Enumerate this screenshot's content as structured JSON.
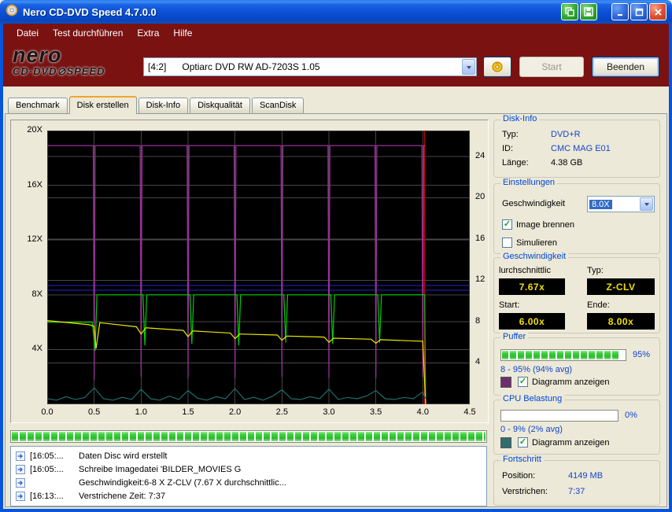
{
  "window": {
    "title": "Nero CD-DVD Speed 4.7.0.0",
    "menu_items": [
      "Datei",
      "Test durchführen",
      "Extra",
      "Hilfe"
    ],
    "logo": {
      "top": "nero",
      "bottom": "CD·DVD⊘SPEED"
    }
  },
  "toolbar": {
    "drive_select": "[4:2]      Optiarc DVD RW AD-7203S 1.05",
    "start_label": "Start",
    "quit_label": "Beenden"
  },
  "tabs": [
    {
      "label": "Benchmark",
      "active": false
    },
    {
      "label": "Disk erstellen",
      "active": true
    },
    {
      "label": "Disk-Info",
      "active": false
    },
    {
      "label": "Diskqualität",
      "active": false
    },
    {
      "label": "ScanDisk",
      "active": false
    }
  ],
  "disk_info": {
    "title": "Disk-Info",
    "rows": [
      {
        "label": "Typ:",
        "value": "DVD+R"
      },
      {
        "label": "ID:",
        "value": "CMC MAG E01"
      },
      {
        "label": "Länge:",
        "value": "4.38 GB"
      }
    ]
  },
  "settings": {
    "title": "Einstellungen",
    "speed_label": "Geschwindigkeit",
    "speed_value": "8.0X",
    "checkbox_burn": "Image brennen",
    "checkbox_sim": "Simulieren"
  },
  "speed_group": {
    "title": "Geschwindigkeit",
    "avg_label": "lurchschnittlic",
    "type_label": "Typ:",
    "avg_value": "7.67x",
    "type_value": "Z-CLV",
    "start_label": "Start:",
    "end_label": "Ende:",
    "start_value": "6.00x",
    "end_value": "8.00x"
  },
  "buffer_group": {
    "title": "Puffer",
    "percent": "95%",
    "range": "8 - 95% (94% avg)",
    "checkbox": "Diagramm anzeigen",
    "bar_percent": 95,
    "swatch_color": "#6e2e6e"
  },
  "cpu_group": {
    "title": "CPU Belastung",
    "percent": "0%",
    "range": "0 - 9% (2% avg)",
    "checkbox": "Diagramm anzeigen",
    "bar_percent": 0,
    "swatch_color": "#2e6e6e"
  },
  "progress_group": {
    "title": "Fortschritt",
    "rows": [
      {
        "label": "Position:",
        "value": "4149 MB"
      },
      {
        "label": "Verstrichen:",
        "value": "7:37"
      }
    ]
  },
  "main_progress": {
    "percent": 100
  },
  "log": {
    "entries": [
      {
        "time": "[16:05:...",
        "text": "Daten Disc wird erstellt"
      },
      {
        "time": "[16:05:...",
        "text": "Schreibe Imagedatei 'BILDER_MOVIES G"
      },
      {
        "time": "",
        "text": "Geschwindigkeit:6-8 X Z-CLV (7.67 X durchschnittlic..."
      },
      {
        "time": "[16:13:...",
        "text": "Verstrichene Zeit: 7:37"
      }
    ]
  },
  "chart_data": {
    "type": "line",
    "title": "DVD+R burn graph (speed / buffer / CPU vs. written GB)",
    "x_max": 4.5,
    "x_ticks": [
      0.0,
      0.5,
      1.0,
      1.5,
      2.0,
      2.5,
      3.0,
      3.5,
      4.0,
      4.5
    ],
    "left_axis": {
      "max": 20,
      "ticks": [
        4,
        8,
        12,
        16,
        20
      ],
      "tick_suffix": "X"
    },
    "right_axis": {
      "max": 26.5,
      "ticks": [
        4,
        8,
        12,
        16,
        20,
        24
      ]
    },
    "background": "#000000",
    "grid_color": "#464646",
    "hlines": [
      {
        "y": 8.33,
        "axis": "left",
        "color": "#2525d8"
      },
      {
        "y": 8.68,
        "axis": "left",
        "color": "#2525d8"
      }
    ],
    "vlines": [
      {
        "x": 4.02,
        "color": "#cc0000"
      }
    ],
    "series": [
      {
        "name": "buffer-level",
        "color": "#993399",
        "axis": "left",
        "points": [
          [
            0,
            18.9
          ],
          [
            0.49,
            18.9
          ],
          [
            0.5,
            1.8
          ],
          [
            0.51,
            18.9
          ],
          [
            0.99,
            18.9
          ],
          [
            1.0,
            2.0
          ],
          [
            1.01,
            18.9
          ],
          [
            1.49,
            18.9
          ],
          [
            1.5,
            1.9
          ],
          [
            1.51,
            18.9
          ],
          [
            1.99,
            18.9
          ],
          [
            2.0,
            1.9
          ],
          [
            2.01,
            18.9
          ],
          [
            2.49,
            18.9
          ],
          [
            2.5,
            2.0
          ],
          [
            2.51,
            18.9
          ],
          [
            2.99,
            18.9
          ],
          [
            3.0,
            1.9
          ],
          [
            3.01,
            18.9
          ],
          [
            3.49,
            18.9
          ],
          [
            3.5,
            1.9
          ],
          [
            3.51,
            18.9
          ],
          [
            3.99,
            18.9
          ],
          [
            4.0,
            2.0
          ],
          [
            4.01,
            18.9
          ],
          [
            4.03,
            18.9
          ]
        ]
      },
      {
        "name": "write-speed",
        "color": "#00cc00",
        "axis": "left",
        "points": [
          [
            0,
            6.0
          ],
          [
            0.48,
            6.0
          ],
          [
            0.51,
            3.9
          ],
          [
            0.53,
            8.0
          ],
          [
            1.02,
            8.0
          ],
          [
            1.04,
            4.3
          ],
          [
            1.06,
            8.0
          ],
          [
            1.52,
            8.0
          ],
          [
            1.54,
            4.4
          ],
          [
            1.56,
            8.0
          ],
          [
            2.02,
            8.0
          ],
          [
            2.04,
            4.3
          ],
          [
            2.06,
            8.0
          ],
          [
            2.52,
            8.0
          ],
          [
            2.54,
            4.5
          ],
          [
            2.56,
            8.0
          ],
          [
            3.02,
            8.0
          ],
          [
            3.04,
            4.4
          ],
          [
            3.06,
            8.0
          ],
          [
            3.52,
            8.0
          ],
          [
            3.54,
            4.5
          ],
          [
            3.56,
            8.0
          ],
          [
            4.02,
            8.0
          ],
          [
            4.03,
            0
          ]
        ]
      },
      {
        "name": "rotation-speed",
        "color": "#e8e800",
        "axis": "right",
        "points": [
          [
            0,
            8.1
          ],
          [
            0.45,
            7.7
          ],
          [
            0.5,
            7.55
          ],
          [
            0.52,
            5.4
          ],
          [
            0.56,
            7.9
          ],
          [
            0.95,
            7.5
          ],
          [
            1.0,
            6.8
          ],
          [
            1.05,
            7.4
          ],
          [
            1.45,
            7.15
          ],
          [
            1.5,
            6.55
          ],
          [
            1.55,
            7.1
          ],
          [
            1.95,
            6.9
          ],
          [
            2.0,
            6.35
          ],
          [
            2.05,
            6.8
          ],
          [
            2.45,
            6.7
          ],
          [
            2.5,
            6.2
          ],
          [
            2.55,
            6.6
          ],
          [
            2.95,
            6.5
          ],
          [
            3.0,
            6.0
          ],
          [
            3.05,
            6.4
          ],
          [
            3.45,
            6.3
          ],
          [
            3.5,
            5.9
          ],
          [
            3.55,
            6.25
          ],
          [
            4.0,
            6.1
          ],
          [
            4.03,
            0
          ]
        ]
      },
      {
        "name": "cpu-usage",
        "color": "#1e6e6e",
        "axis": "left",
        "points": [
          [
            0,
            0.4
          ],
          [
            0.1,
            0.3
          ],
          [
            0.2,
            0.55
          ],
          [
            0.3,
            0.35
          ],
          [
            0.4,
            0.5
          ],
          [
            0.5,
            1.2
          ],
          [
            0.6,
            0.4
          ],
          [
            0.7,
            0.3
          ],
          [
            0.8,
            0.5
          ],
          [
            0.9,
            0.35
          ],
          [
            1.0,
            1.1
          ],
          [
            1.1,
            0.4
          ],
          [
            1.2,
            0.3
          ],
          [
            1.3,
            0.6
          ],
          [
            1.4,
            0.35
          ],
          [
            1.5,
            1.0
          ],
          [
            1.6,
            0.45
          ],
          [
            1.7,
            0.3
          ],
          [
            1.8,
            0.55
          ],
          [
            1.9,
            0.4
          ],
          [
            2.0,
            1.15
          ],
          [
            2.1,
            0.35
          ],
          [
            2.2,
            0.5
          ],
          [
            2.3,
            0.3
          ],
          [
            2.4,
            0.6
          ],
          [
            2.5,
            1.05
          ],
          [
            2.6,
            0.4
          ],
          [
            2.7,
            0.35
          ],
          [
            2.8,
            0.55
          ],
          [
            2.9,
            0.4
          ],
          [
            3.0,
            1.1
          ],
          [
            3.1,
            0.35
          ],
          [
            3.2,
            0.5
          ],
          [
            3.3,
            0.4
          ],
          [
            3.4,
            0.6
          ],
          [
            3.5,
            1.0
          ],
          [
            3.6,
            0.4
          ],
          [
            3.7,
            0.35
          ],
          [
            3.8,
            0.5
          ],
          [
            3.9,
            0.4
          ],
          [
            4.0,
            0.9
          ],
          [
            4.03,
            0.4
          ]
        ]
      }
    ]
  }
}
